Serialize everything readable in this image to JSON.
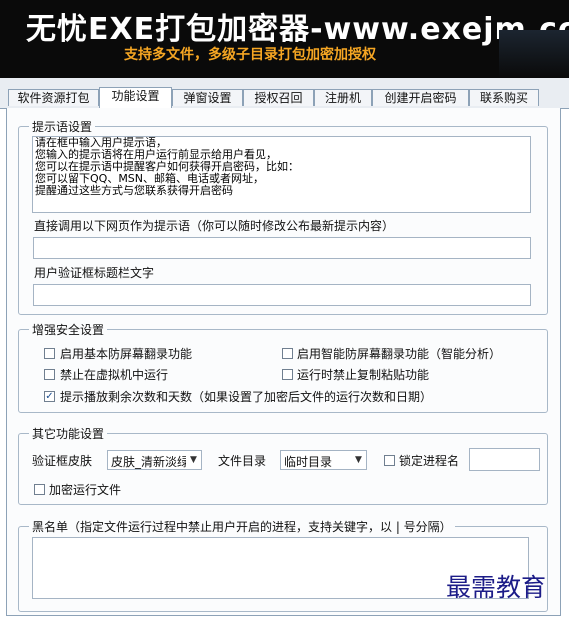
{
  "banner": {
    "title": "无忧EXE打包加密器-www.exejm.com",
    "subtitle": "支持多文件，多级子目录打包加密加授权"
  },
  "tabs": [
    {
      "label": "软件资源打包",
      "active": false
    },
    {
      "label": "功能设置",
      "active": true
    },
    {
      "label": "弹窗设置",
      "active": false
    },
    {
      "label": "授权召回",
      "active": false
    },
    {
      "label": "注册机",
      "active": false
    },
    {
      "label": "创建开启密码",
      "active": false
    },
    {
      "label": "联系购买",
      "active": false
    }
  ],
  "prompt_group": {
    "legend": "提示语设置",
    "text": "请在框中输入用户提示语，\n您输入的提示语将在用户运行前显示给用户看见，\n您可以在提示语中提醒客户如何获得开启密码，比如：\n您可以留下QQ、MSN、邮箱、电话或者网址，\n提醒通过这些方式与您联系获得开启密码",
    "url_label": "直接调用以下网页作为提示语（你可以随时修改公布最新提示内容）",
    "url_value": "",
    "caption_label": "用户验证框标题栏文字",
    "caption_value": ""
  },
  "security_group": {
    "legend": "增强安全设置",
    "options": [
      {
        "label": "启用基本防屏幕翻录功能",
        "checked": false
      },
      {
        "label": "启用智能防屏幕翻录功能（智能分析）",
        "checked": false
      },
      {
        "label": "禁止在虚拟机中运行",
        "checked": false
      },
      {
        "label": "运行时禁止复制粘贴功能",
        "checked": false
      },
      {
        "label": "提示播放剩余次数和天数（如果设置了加密后文件的运行次数和日期）",
        "checked": true
      }
    ]
  },
  "other_group": {
    "legend": "其它功能设置",
    "skin_label": "验证框皮肤",
    "skin_value": "皮肤_清新淡绿",
    "dir_label": "文件目录",
    "dir_value": "临时目录",
    "lock_label": "锁定进程名",
    "lock_checked": false,
    "lock_value": "",
    "encrypt_label": "加密运行文件",
    "encrypt_checked": false
  },
  "blacklist_group": {
    "legend": "黑名单（指定文件运行过程中禁止用户开启的进程，支持关键字，以 | 号分隔）",
    "value": ""
  },
  "watermark": "最需教育",
  "colors": {
    "banner_bg": "#0a0a0a",
    "title_color": "#ffffff",
    "subtitle_color": "#f6a623",
    "tab_border": "#8da2b7",
    "watermark_color": "#1c1c88"
  }
}
